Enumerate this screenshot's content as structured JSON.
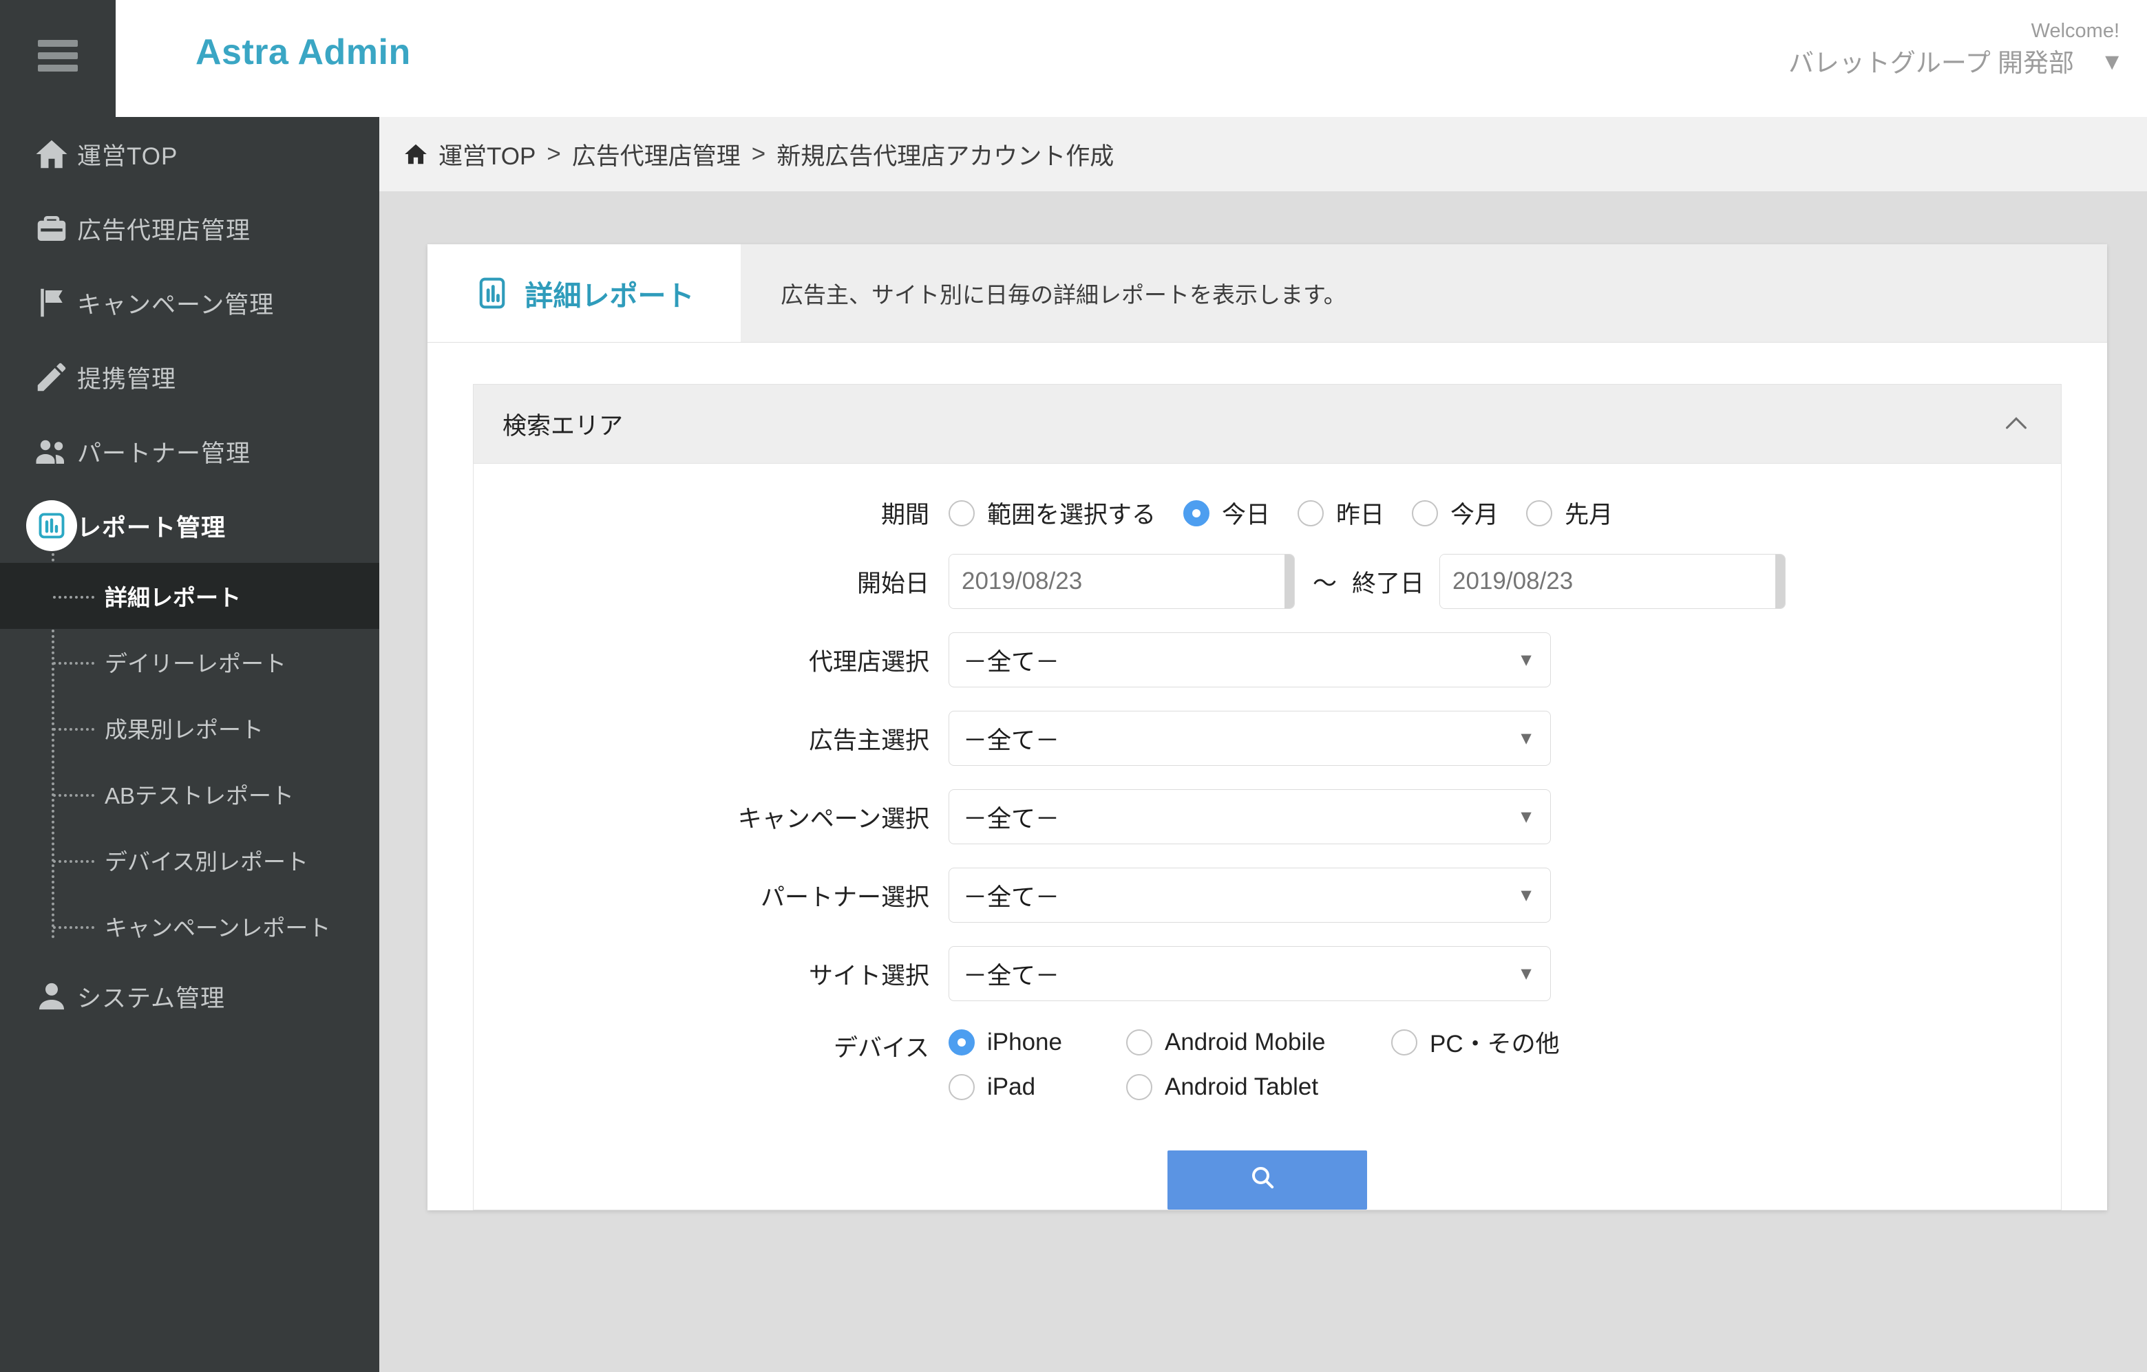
{
  "header": {
    "brand": "Astra Admin",
    "welcome": "Welcome!",
    "user_name": "バレットグループ 開発部",
    "caret": "▼"
  },
  "sidebar": {
    "items": [
      {
        "label": "運営TOP",
        "icon": "home-icon",
        "active": false
      },
      {
        "label": "広告代理店管理",
        "icon": "briefcase-icon",
        "active": false
      },
      {
        "label": "キャンペーン管理",
        "icon": "flag-icon",
        "active": false
      },
      {
        "label": "提携管理",
        "icon": "pencil-icon",
        "active": false
      },
      {
        "label": "パートナー管理",
        "icon": "people-icon",
        "active": false
      },
      {
        "label": "レポート管理",
        "icon": "chart-icon",
        "active": true
      },
      {
        "label": "システム管理",
        "icon": "person-icon",
        "active": false
      }
    ],
    "submenu": [
      {
        "label": "詳細レポート",
        "active": true
      },
      {
        "label": "デイリーレポート",
        "active": false
      },
      {
        "label": "成果別レポート",
        "active": false
      },
      {
        "label": "ABテストレポート",
        "active": false
      },
      {
        "label": "デバイス別レポート",
        "active": false
      },
      {
        "label": "キャンペーンレポート",
        "active": false
      }
    ]
  },
  "breadcrumb": {
    "home_icon": "home-icon",
    "items": [
      "運営TOP",
      "広告代理店管理",
      "新規広告代理店アカウント作成"
    ],
    "separator": ">"
  },
  "tab": {
    "icon": "report-chart-icon",
    "label": "詳細レポート",
    "description": "広告主、サイト別に日毎の詳細レポートを表示します。"
  },
  "search_panel": {
    "title": "検索エリア",
    "collapse_icon": "chevron-up-icon",
    "period": {
      "label": "期間",
      "options": [
        {
          "label": "範囲を選択する",
          "selected": false
        },
        {
          "label": "今日",
          "selected": true
        },
        {
          "label": "昨日",
          "selected": false
        },
        {
          "label": "今月",
          "selected": false
        },
        {
          "label": "先月",
          "selected": false
        }
      ]
    },
    "start_date": {
      "label": "開始日",
      "value": "",
      "placeholder": "2019/08/23",
      "calendar_icon": "calendar-icon"
    },
    "range_separator": "～",
    "end_date": {
      "label": "終了日",
      "value": "",
      "placeholder": "2019/08/23",
      "calendar_icon": "calendar-icon"
    },
    "selects": [
      {
        "label": "代理店選択",
        "value": "－全て－"
      },
      {
        "label": "広告主選択",
        "value": "－全て－"
      },
      {
        "label": "キャンペーン選択",
        "value": "－全て－"
      },
      {
        "label": "パートナー選択",
        "value": "－全て－"
      },
      {
        "label": "サイト選択",
        "value": "－全て－"
      }
    ],
    "select_arrow": "▼",
    "device": {
      "label": "デバイス",
      "row1": [
        {
          "label": "iPhone",
          "selected": true
        },
        {
          "label": "Android Mobile",
          "selected": false
        },
        {
          "label": "PC・その他",
          "selected": false
        }
      ],
      "row2": [
        {
          "label": "iPad",
          "selected": false
        },
        {
          "label": "Android Tablet",
          "selected": false
        }
      ]
    },
    "submit_label": ""
  },
  "colors": {
    "brand_teal": "#3aa6c4",
    "sidebar_dark": "#373b3c",
    "sidebar_active": "#242727",
    "radio_blue": "#4d9ef0",
    "button_blue": "#5b94e3",
    "tab_teal": "#2f9cbb"
  }
}
